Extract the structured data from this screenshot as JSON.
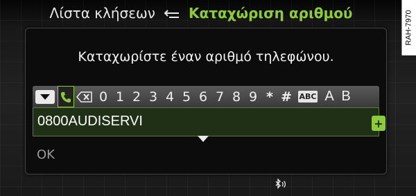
{
  "header": {
    "previous": "Λίστα κλήσεων",
    "current": "Καταχώριση αριθμού",
    "back_icon": "return-arrow-icon"
  },
  "side_label": "RAH-7970",
  "dialog": {
    "prompt": "Καταχωρίστε έναν αριθμό τηλεφώνου.",
    "keyboard": {
      "dropdown_icon": "triangle-down-icon",
      "phone_icon": "phone-icon",
      "backspace_icon": "backspace-icon",
      "digits": [
        "0",
        "1",
        "2",
        "3",
        "4",
        "5",
        "6",
        "7",
        "8",
        "9"
      ],
      "symbols": [
        "*",
        "#"
      ],
      "mode_label": "ABC",
      "letters": [
        "A",
        "B"
      ]
    },
    "entry_value": "0800AUDISERVI",
    "ok_label": "OK"
  },
  "status": {
    "bluetooth_icon": "bluetooth-audio-icon"
  },
  "colors": {
    "accent": "#8ecb3c",
    "background": "#101010",
    "entry_bg": "#1f3017"
  }
}
